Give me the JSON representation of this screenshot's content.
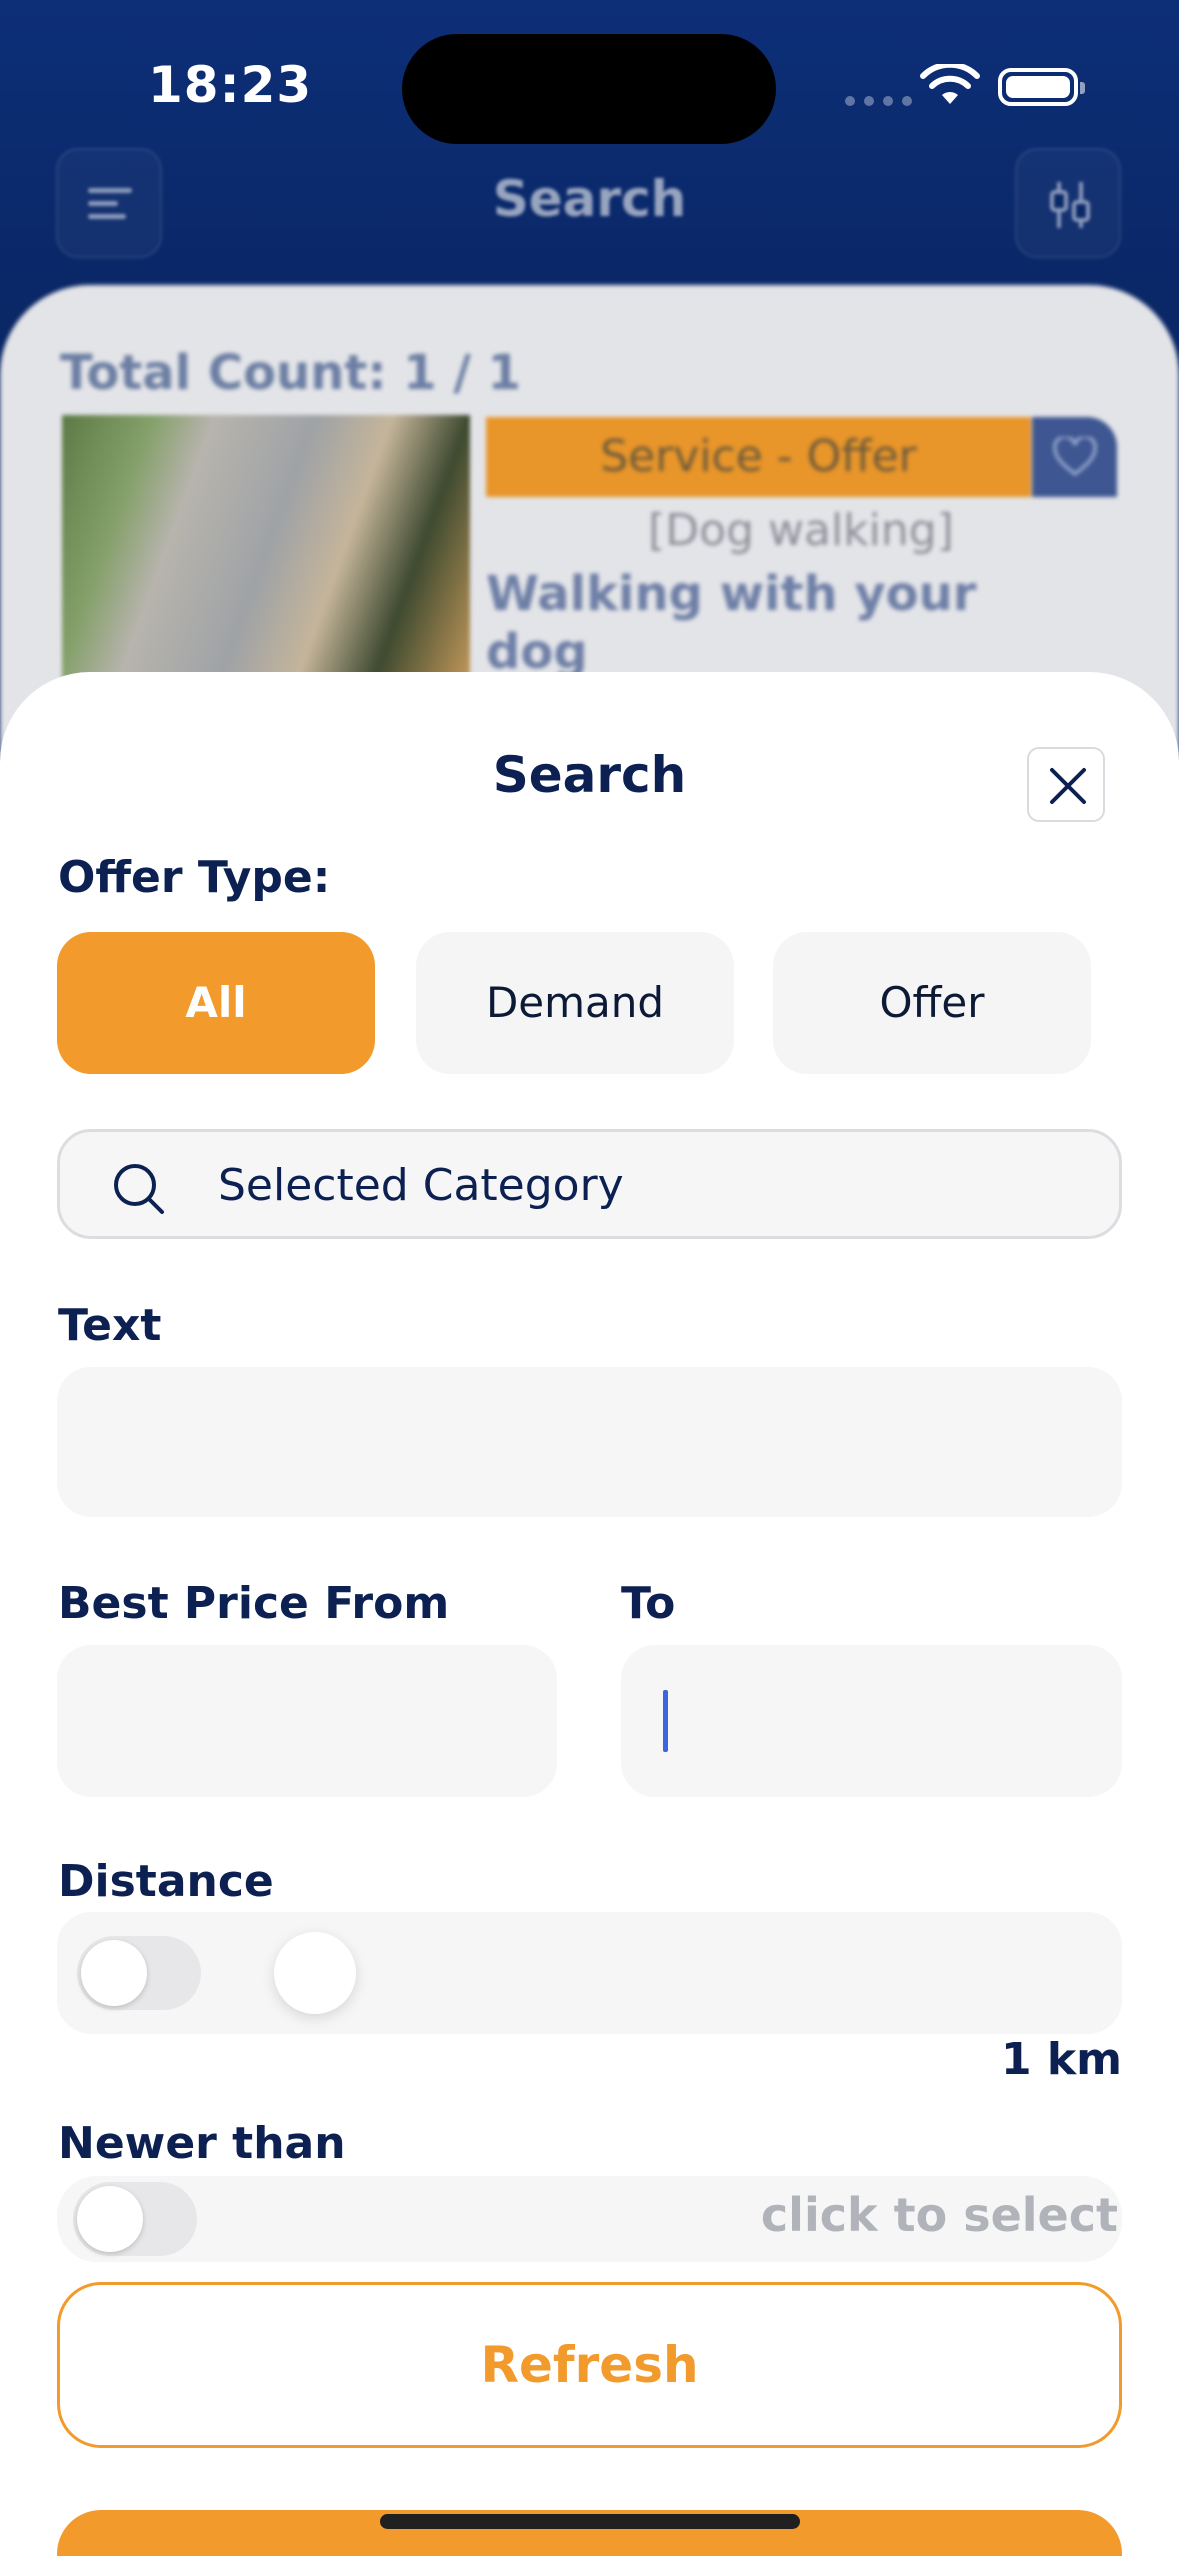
{
  "status_bar": {
    "time": "18:23"
  },
  "navbar": {
    "title": "Search"
  },
  "results": {
    "total_count": "Total Count: 1 / 1",
    "listing": {
      "badge": "Service - Offer",
      "category": "[Dog walking]",
      "title": "Walking with your dog"
    }
  },
  "sheet": {
    "title": "Search",
    "offer_type_label": "Offer Type:",
    "offer_types": [
      "All",
      "Demand",
      "Offer"
    ],
    "selected_offer_type": "All",
    "category_placeholder": "Selected Category",
    "text_label": "Text",
    "text_value": "",
    "price_from_label": "Best Price From",
    "price_to_label": "To",
    "price_from_value": "",
    "price_to_value": "",
    "distance_label": "Distance",
    "distance_enabled": false,
    "distance_value": "1 km",
    "newer_than_label": "Newer than",
    "newer_than_enabled": false,
    "newer_than_placeholder": "click to select",
    "refresh_label": "Refresh"
  },
  "colors": {
    "accent": "#f29a2b",
    "navy": "#0c2152",
    "header_bg": "#0a2766"
  }
}
